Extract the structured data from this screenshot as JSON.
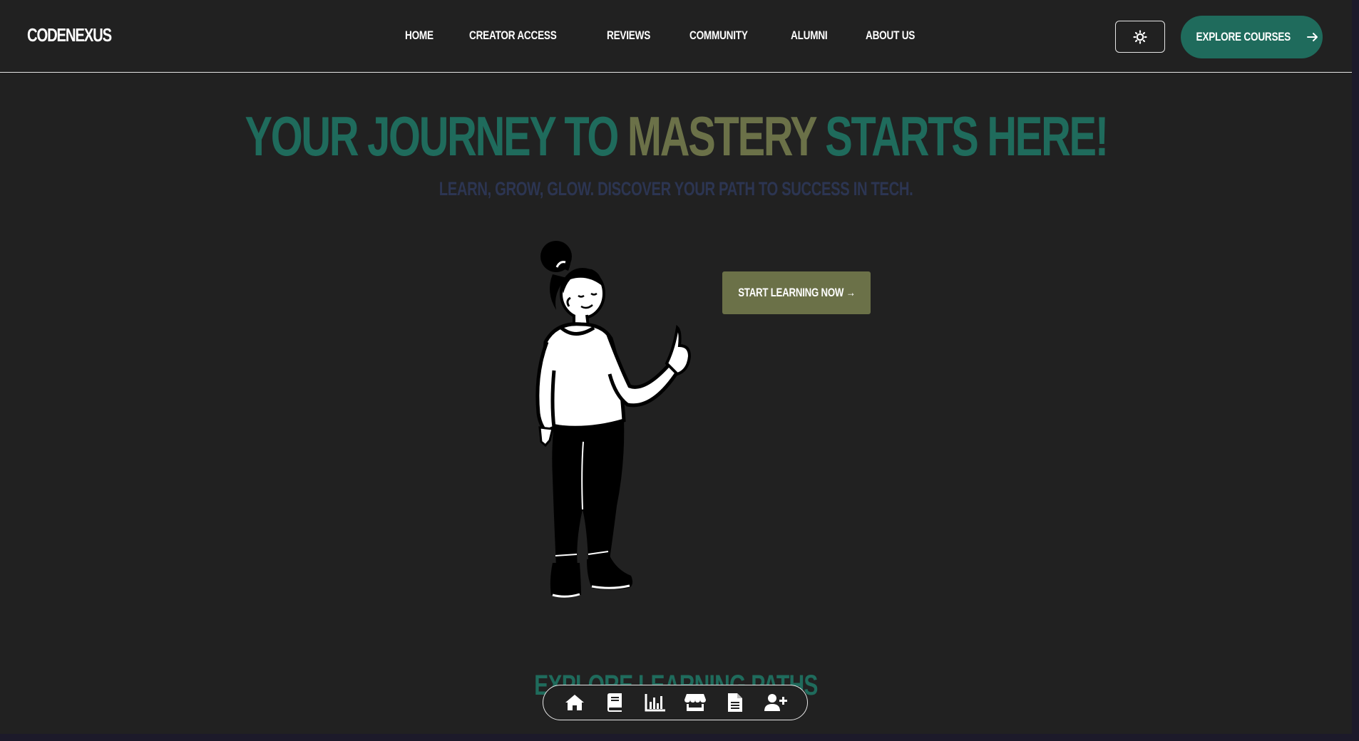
{
  "header": {
    "logo": "CODENEXUS",
    "nav": [
      "HOME",
      "CREATOR ACCESS",
      "REVIEWS",
      "COMMUNITY",
      "ALUMNI",
      "ABOUT US"
    ],
    "theme_toggle_icon": "sun-icon",
    "explore_label": "EXPLORE COURSES"
  },
  "hero": {
    "title_part1": "YOUR JOURNEY TO ",
    "title_highlight": "MASTERY",
    "title_part2": " STARTS HERE!",
    "subtitle": "LEARN, GROW, GLOW. DISCOVER YOUR PATH TO SUCCESS IN TECH.",
    "cta_label": "START LEARNING NOW →"
  },
  "section": {
    "paths_title": "EXPLORE LEARNING PATHS"
  },
  "dock": {
    "items": [
      "home-icon",
      "book-icon",
      "chart-icon",
      "store-icon",
      "document-icon",
      "add-user-icon"
    ]
  },
  "colors": {
    "accent_green": "#1f6b5c",
    "accent_olive": "#6b7148",
    "background": "#212121",
    "subtitle": "#2c3552"
  }
}
